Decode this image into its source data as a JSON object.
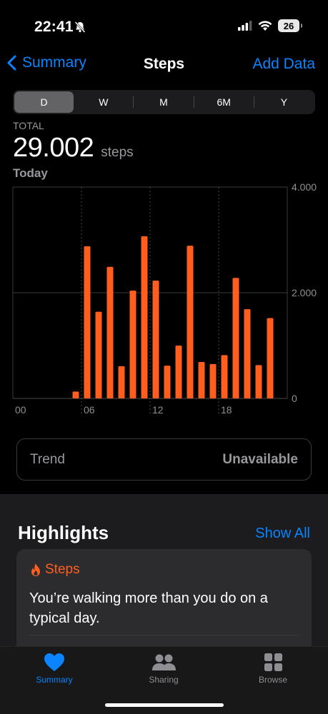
{
  "status_bar": {
    "time": "22:41",
    "battery": "26"
  },
  "nav": {
    "back_label": "Summary",
    "title": "Steps",
    "action_label": "Add Data"
  },
  "range_tabs": [
    "D",
    "W",
    "M",
    "6M",
    "Y"
  ],
  "active_range": "D",
  "summary": {
    "total_label": "TOTAL",
    "total_value": "29.002",
    "unit": "steps",
    "date_label": "Today"
  },
  "chart_data": {
    "type": "bar",
    "title": "",
    "xlabel": "",
    "ylabel": "",
    "x_ticks": [
      "00",
      "06",
      "12",
      "18"
    ],
    "y_ticks": [
      "4.000",
      "2.000",
      "0"
    ],
    "ylim": [
      0,
      4000
    ],
    "grid": true,
    "bar_color": "#ff5e1f",
    "categories": [
      "00",
      "01",
      "02",
      "03",
      "04",
      "05",
      "06",
      "07",
      "08",
      "09",
      "10",
      "11",
      "12",
      "13",
      "14",
      "15",
      "16",
      "17",
      "18",
      "19",
      "20",
      "21",
      "22",
      "23"
    ],
    "values": [
      0,
      0,
      0,
      0,
      0,
      130,
      2880,
      1640,
      2490,
      610,
      2040,
      3070,
      2230,
      620,
      1000,
      2890,
      690,
      650,
      820,
      2280,
      1690,
      630,
      1520,
      0
    ]
  },
  "trend": {
    "label": "Trend",
    "value": "Unavailable"
  },
  "highlights": {
    "title": "Highlights",
    "show_all": "Show All",
    "card": {
      "category": "Steps",
      "text": "You’re walking more than you do on a typical day."
    }
  },
  "tab_bar": [
    {
      "label": "Summary",
      "icon": "heart-icon",
      "active": true
    },
    {
      "label": "Sharing",
      "icon": "people-icon",
      "active": false
    },
    {
      "label": "Browse",
      "icon": "grid-icon",
      "active": false
    }
  ],
  "colors": {
    "accent": "#0a84ff",
    "steps": "#ff5e1f"
  }
}
